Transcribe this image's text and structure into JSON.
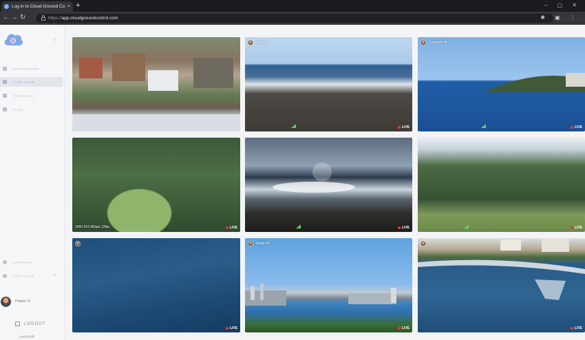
{
  "browser": {
    "tab_title": "Log in to Cloud Ground Control",
    "tab_close": "×",
    "new_tab": "+",
    "back": "←",
    "forward": "→",
    "reload": "↻",
    "url_scheme": "https://",
    "url_host": "app.cloudgroundcontrol.com",
    "window_controls": "– ▢ ✕",
    "toolbar_icons": "✱ ▣ ⋮"
  },
  "sidebar": {
    "collapse_glyph": "‹",
    "nav": [
      {
        "label": "DASHBOARD",
        "active": false
      },
      {
        "label": "LIVE VIEW",
        "active": true
      },
      {
        "label": "VEHICLES",
        "active": false
      },
      {
        "label": "ALSA",
        "active": false
      }
    ],
    "support_label": "SUPPORT",
    "settings_label": "SETTINGS",
    "settings_chevron": "^",
    "user_name": "Parker H",
    "logout_label": "LOGOUT",
    "version": "cbe0e046"
  },
  "feeds": [
    {
      "pilot": "",
      "stats": "",
      "live_label": ""
    },
    {
      "pilot": "Corey S",
      "stats": "",
      "live_label": "LIVE"
    },
    {
      "pilot": "Cameron W",
      "stats": "",
      "live_label": "LIVE"
    },
    {
      "pilot": "",
      "stats": "1000 616.9Kbps 12fps",
      "live_label": "LIVE"
    },
    {
      "pilot": "",
      "stats": "",
      "live_label": "LIVE"
    },
    {
      "pilot": "",
      "stats": "",
      "live_label": "LIVE"
    },
    {
      "pilot": "",
      "stats": "",
      "live_label": "LIVE"
    },
    {
      "pilot": "Sadie W",
      "stats": "",
      "live_label": "LIVE"
    },
    {
      "pilot": "",
      "stats": "",
      "live_label": "LIVE"
    }
  ],
  "colors": {
    "live_dot": "#e53935",
    "signal": "#5fd05f",
    "active_nav_bg": "#e2e5ea"
  }
}
